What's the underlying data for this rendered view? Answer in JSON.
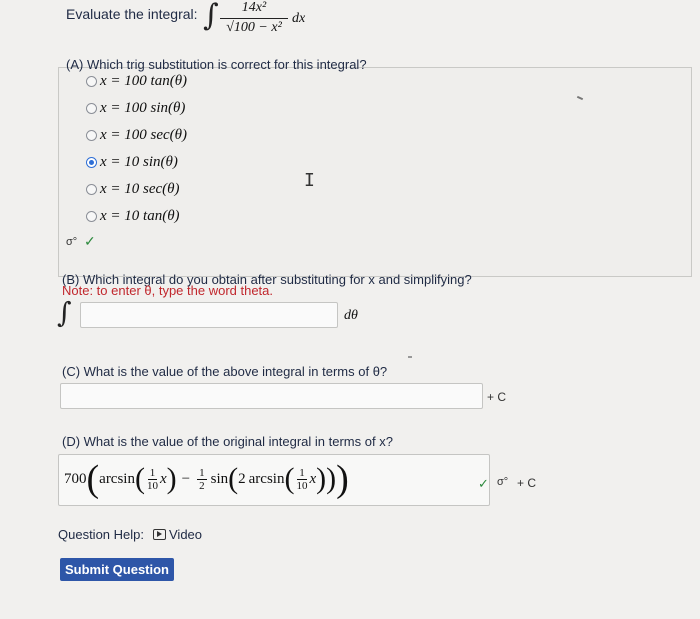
{
  "header": {
    "prefix": "Evaluate the integral:",
    "integrand_numerator": "14x²",
    "integrand_denominator": "√100 − x²",
    "differential": "dx"
  },
  "part_a": {
    "question": "(A) Which trig substitution is correct for this integral?",
    "options": [
      {
        "label": "x = 100 tan(θ)",
        "selected": false
      },
      {
        "label": "x = 100 sin(θ)",
        "selected": false
      },
      {
        "label": "x = 100 sec(θ)",
        "selected": false
      },
      {
        "label": "x = 10 sin(θ)",
        "selected": true
      },
      {
        "label": "x = 10 sec(θ)",
        "selected": false
      },
      {
        "label": "x = 10 tan(θ)",
        "selected": false
      }
    ],
    "check_mark": "✓"
  },
  "part_b": {
    "question": "(B) Which integral do you obtain after substituting for x and simplifying?",
    "note": "Note: to enter θ, type the word theta.",
    "input_value": "",
    "suffix": "dθ"
  },
  "part_c": {
    "question": "(C) What is the value of the above integral in terms of θ?",
    "input_value": "",
    "suffix": "+ C"
  },
  "part_d": {
    "question": "(D) What is the value of the original integral in terms of x?",
    "answer": {
      "coef": "700",
      "fn1": "arcsin",
      "frac1_num": "1",
      "frac1_den": "10",
      "var": "x",
      "minus": "−",
      "frac2_num": "1",
      "frac2_den": "2",
      "fn2": "sin",
      "inner_coef": "2",
      "fn3": "arcsin",
      "frac3_num": "1",
      "frac3_den": "10"
    },
    "check_mark": "✓",
    "suffix": "+ C"
  },
  "help": {
    "label": "Question Help:",
    "video_label": "Video"
  },
  "submit_label": "Submit Question",
  "colors": {
    "accent": "#2e56a8",
    "radio_selected": "#2f6fd6",
    "note_red": "#c1272d",
    "check_green": "#2d8a3e"
  },
  "icons": {
    "signature": "σ°"
  }
}
